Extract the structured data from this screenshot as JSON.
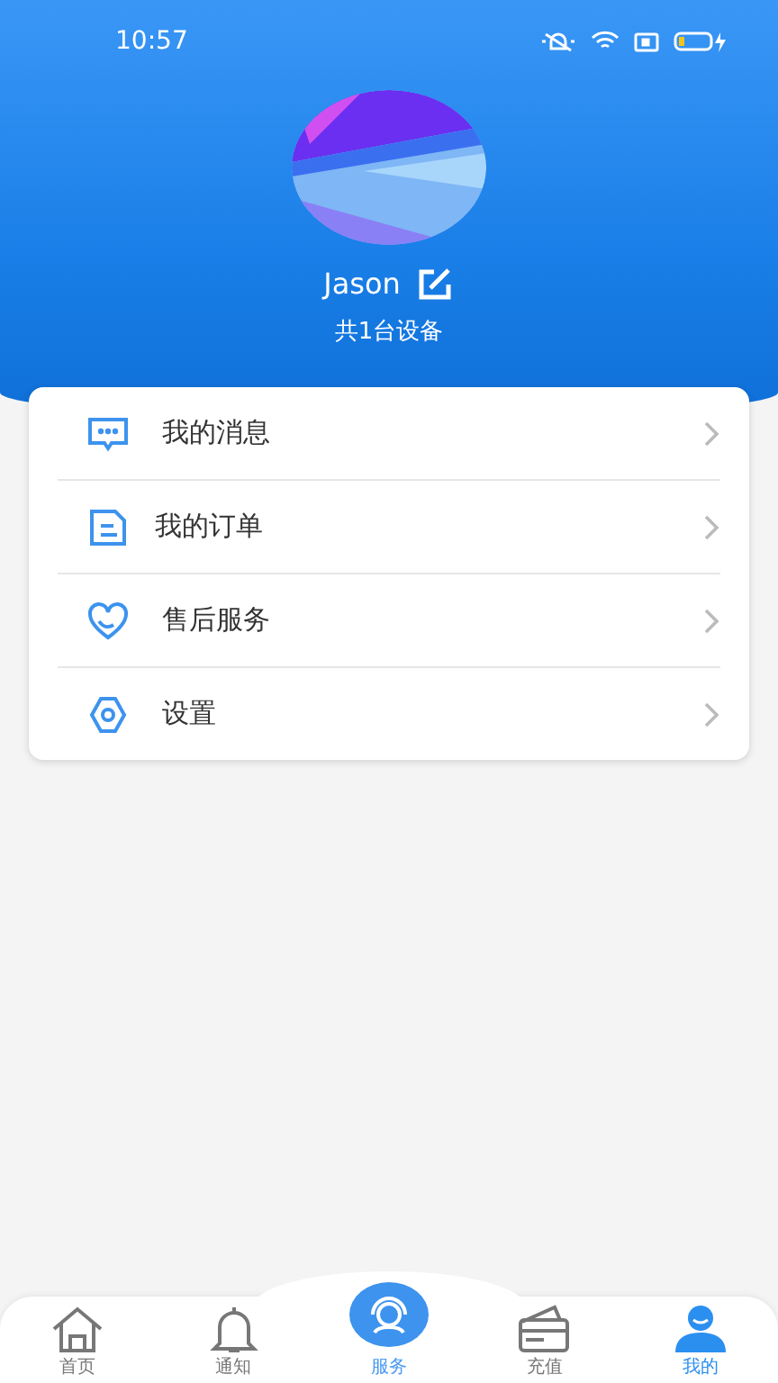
{
  "status_bar": {
    "time": "10:57"
  },
  "profile": {
    "name": "Jason",
    "devices": "共1台设备"
  },
  "menu": [
    {
      "kind": "message",
      "label": "我的消息"
    },
    {
      "kind": "order",
      "label": "我的订单"
    },
    {
      "kind": "service",
      "label": "售后服务"
    },
    {
      "kind": "settings",
      "label": "设置"
    }
  ],
  "tabs": [
    {
      "kind": "home",
      "label": "首页",
      "selected": false
    },
    {
      "kind": "bell",
      "label": "通知",
      "selected": false
    },
    {
      "kind": "center",
      "label": "服务",
      "selected": false
    },
    {
      "kind": "card",
      "label": "充值",
      "selected": false
    },
    {
      "kind": "user",
      "label": "我的",
      "selected": true
    }
  ]
}
